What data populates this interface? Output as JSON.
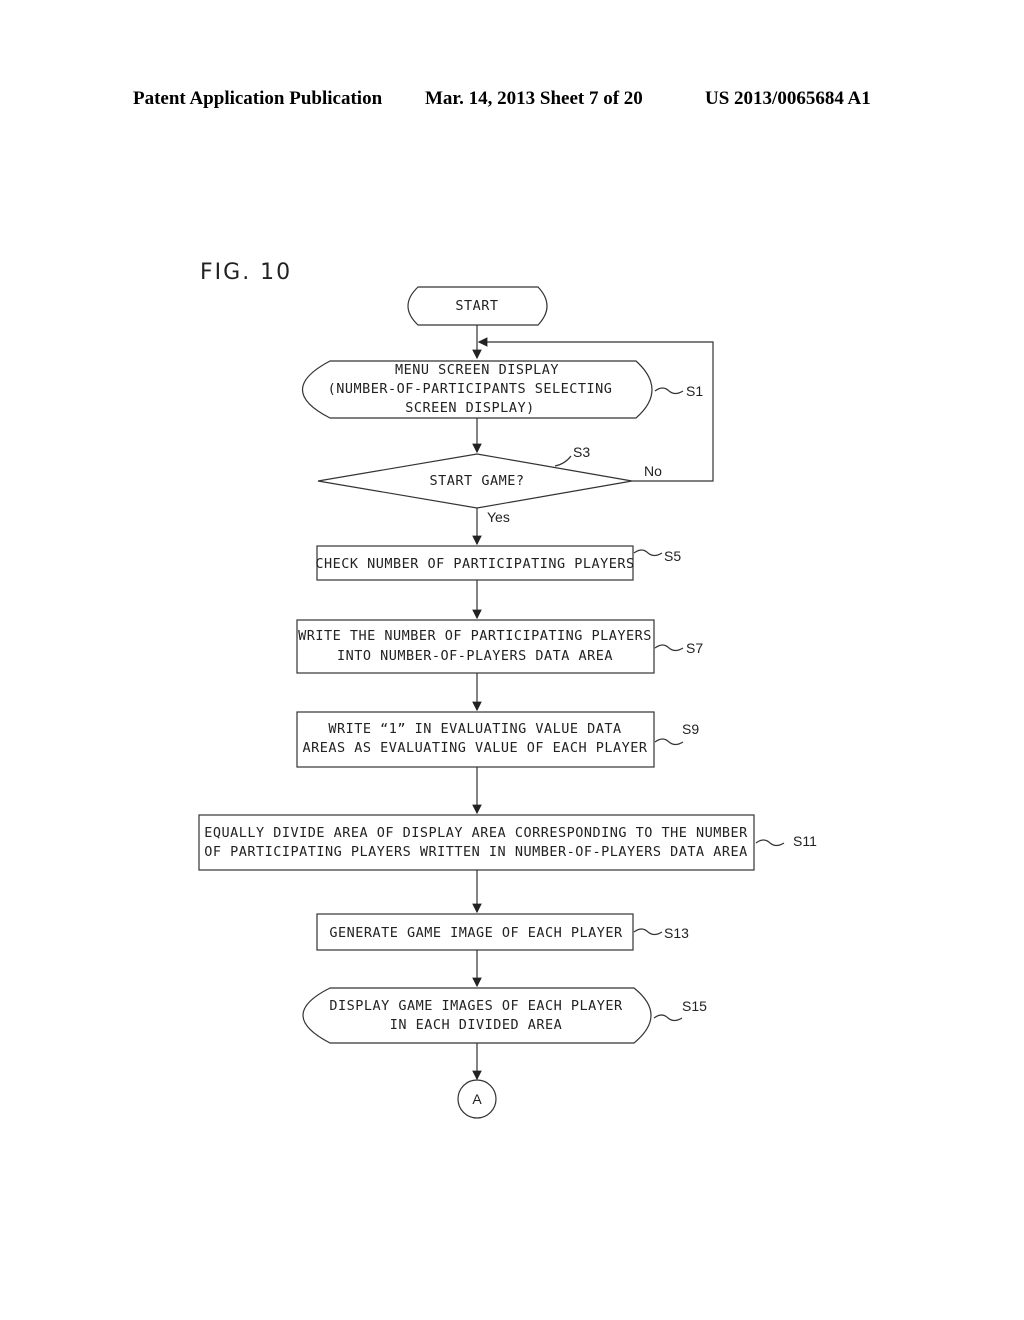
{
  "header": {
    "left": "Patent Application Publication",
    "center": "Mar. 14, 2013  Sheet 7 of 20",
    "right": "US 2013/0065684 A1"
  },
  "figure": {
    "label": "FIG. 10",
    "start": "START",
    "steps": {
      "s1": {
        "id": "S1",
        "lines": [
          "MENU SCREEN DISPLAY",
          "(NUMBER-OF-PARTICIPANTS SELECTING",
          "SCREEN DISPLAY)"
        ]
      },
      "s3": {
        "id": "S3",
        "text": "START GAME?",
        "yes": "Yes",
        "no": "No"
      },
      "s5": {
        "id": "S5",
        "lines": [
          "CHECK NUMBER OF PARTICIPATING PLAYERS"
        ]
      },
      "s7": {
        "id": "S7",
        "lines": [
          "WRITE THE NUMBER OF PARTICIPATING PLAYERS",
          "INTO NUMBER-OF-PLAYERS DATA AREA"
        ]
      },
      "s9": {
        "id": "S9",
        "lines": [
          "WRITE  “1”  IN EVALUATING VALUE DATA",
          "AREAS AS EVALUATING VALUE OF EACH PLAYER"
        ]
      },
      "s11": {
        "id": "S11",
        "lines": [
          "EQUALLY DIVIDE AREA OF DISPLAY AREA CORRESPONDING TO THE NUMBER",
          "OF PARTICIPATING PLAYERS WRITTEN IN NUMBER-OF-PLAYERS DATA AREA"
        ]
      },
      "s13": {
        "id": "S13",
        "lines": [
          "GENERATE GAME IMAGE OF EACH PLAYER"
        ]
      },
      "s15": {
        "id": "S15",
        "lines": [
          "DISPLAY GAME IMAGES OF EACH PLAYER",
          "IN EACH DIVIDED AREA"
        ]
      }
    },
    "connector": "A"
  }
}
